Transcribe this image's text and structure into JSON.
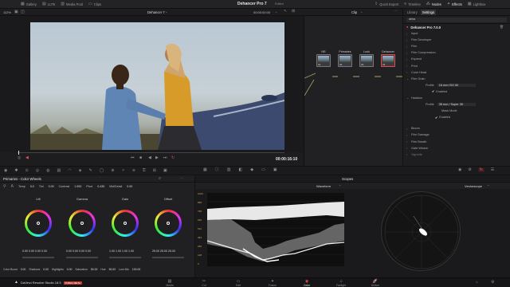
{
  "topbar": {
    "left_items": [
      {
        "icon": "media-pool-icon",
        "label": "Gallery"
      },
      {
        "icon": "luts-icon",
        "label": "LUTs"
      },
      {
        "icon": "media-pool-icon",
        "label": "Media Pool"
      },
      {
        "icon": "clips-icon",
        "label": "Clips"
      }
    ],
    "project_title": "Dehancer Pro 7",
    "project_status": "Edited",
    "right_items": [
      {
        "icon": "quick-export-icon",
        "label": "Quick Export"
      },
      {
        "icon": "timeline-icon",
        "label": "Timeline"
      },
      {
        "icon": "nodes-icon",
        "label": "Nodes"
      },
      {
        "icon": "effects-icon",
        "label": "Effects"
      },
      {
        "icon": "lightbox-icon",
        "label": "Lightbox"
      }
    ]
  },
  "viewer_bar": {
    "zoom": "112%",
    "clip_name": "Dehancer 7",
    "timecode": "00:00:00:00",
    "node_mode": "Clip"
  },
  "transport": {
    "timecode": "00:00:16:10"
  },
  "nodes": [
    {
      "label": "NR",
      "num": "01"
    },
    {
      "label": "Primaries",
      "num": "02"
    },
    {
      "label": "Look",
      "num": "03"
    },
    {
      "label": "Dehancer",
      "num": "04"
    }
  ],
  "panel": {
    "tabs": [
      "Library",
      "Settings"
    ],
    "search": "deha",
    "plugin_title": "Dehancer Pro 7.0.0",
    "sections": [
      "Input",
      "Film Developer",
      "Film",
      "Film Compression",
      "Expand",
      "Print",
      "Color Head",
      "Film Grain"
    ],
    "grain_profile_label": "Profile",
    "grain_profile_value": "16 mm ISO 50",
    "grain_enabled": "Enabled",
    "halation_label": "Halation",
    "halation_profile_label": "Profile",
    "halation_profile_value": "35 mm / Super 35",
    "mask_mode": "Mask Mode",
    "halation_enabled": "Enabled",
    "sections2": [
      "Bloom",
      "Film Damage",
      "Film Breath",
      "Gate Weave"
    ],
    "more": "Vignette"
  },
  "colorwheels": {
    "title": "Primaries - Color Wheels",
    "params": [
      {
        "label": "Temp",
        "value": "0.0"
      },
      {
        "label": "Tint",
        "value": "0.00"
      },
      {
        "label": "Contrast",
        "value": "1.000"
      },
      {
        "label": "Pivot",
        "value": "0.435"
      },
      {
        "label": "Mid/Detail",
        "value": "0.00"
      }
    ],
    "wheels": [
      {
        "name": "Lift",
        "values": "0.00  0.00  0.00  0.00"
      },
      {
        "name": "Gamma",
        "values": "0.00  0.00  0.00  0.00"
      },
      {
        "name": "Gain",
        "values": "1.00  1.00  1.00  1.00"
      },
      {
        "name": "Offset",
        "values": "25.00  25.00  25.00"
      }
    ],
    "bottom_params": [
      {
        "label": "Color Boost",
        "value": "0.00"
      },
      {
        "label": "Shadows",
        "value": "0.00"
      },
      {
        "label": "Highlights",
        "value": "0.00"
      },
      {
        "label": "Saturation",
        "value": "50.00"
      },
      {
        "label": "Hue",
        "value": "50.00"
      },
      {
        "label": "Lum Mix",
        "value": "100.00"
      }
    ]
  },
  "scopes": {
    "title": "Scopes",
    "waveform_label": "Waveform",
    "vectorscope_label": "Vectorscope",
    "scale": [
      "1023",
      "896",
      "768",
      "640",
      "512",
      "384",
      "256",
      "128",
      "0"
    ]
  },
  "bottom_bar": {
    "app_name": "DaVinci Resolve Studio 18.5",
    "badge": "PUBLIC BETA",
    "pages": [
      {
        "label": "Media",
        "icon": "media-page-icon"
      },
      {
        "label": "Cut",
        "icon": "cut-page-icon"
      },
      {
        "label": "Edit",
        "icon": "edit-page-icon"
      },
      {
        "label": "Fusion",
        "icon": "fusion-page-icon"
      },
      {
        "label": "Color",
        "icon": "color-page-icon"
      },
      {
        "label": "Fairlight",
        "icon": "fairlight-page-icon"
      },
      {
        "label": "Deliver",
        "icon": "deliver-page-icon"
      }
    ],
    "active_page": "Color"
  },
  "colors": {
    "accent_red": "#e64a4a",
    "accent_blue": "#5ea0f5"
  }
}
